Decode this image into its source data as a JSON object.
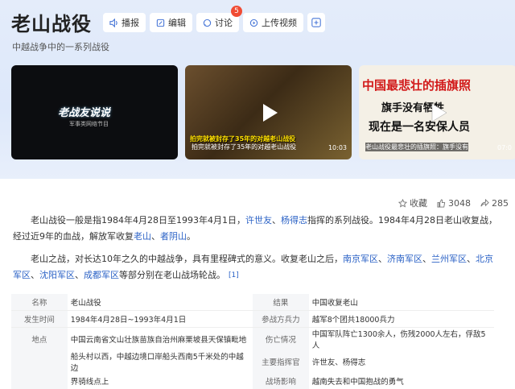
{
  "title": "老山战役",
  "subtitle": "中越战争中的一系列战役",
  "actions": [
    {
      "label": "播报",
      "icon": "speaker-icon"
    },
    {
      "label": "编辑",
      "icon": "edit-icon"
    },
    {
      "label": "讨论",
      "icon": "comment-icon",
      "badge": "5"
    },
    {
      "label": "上传视频",
      "icon": "video-icon"
    }
  ],
  "videos": [
    {
      "overlay": "老战友说说",
      "subtitle": "军事类网络节目",
      "caption": "",
      "duration": ""
    },
    {
      "overlay": "拍完就被封存了35年的对越老山战役",
      "caption": "拍完就被封存了35年的对越老山战役",
      "duration": "10:03"
    },
    {
      "overlay": "中国最悲壮的插旗照",
      "overlay2": "旗手没有牺牲",
      "overlay3": "现在是一名安保人员",
      "caption": "老山战役最悲壮的插旗照：旗手没有",
      "duration": "07:0"
    }
  ],
  "stats": {
    "collect": "收藏",
    "likes": "3048",
    "shares": "285"
  },
  "intro": {
    "p1": "老山战役一般是指1984年4月28日至1993年4月1日，",
    "p1_link1": "许世友",
    "p1_sep": "、",
    "p1_link2": "杨得志",
    "p1_b": "指挥的系列战役。1984年4月28日老山收复战，经过近9年的血战，解放军收复",
    "p1_link3": "老山",
    "p1_sep2": "、",
    "p1_link4": "者阴山",
    "p1_end": "。",
    "p2": "老山之战，对长达10年之久的中越战争，具有里程碑式的意义。收复老山之后，",
    "p2_links": [
      "南京军区",
      "济南军区",
      "兰州军区",
      "北京军区",
      "沈阳军区",
      "成都军区"
    ],
    "p2_sep": "、",
    "p2_end": "等部分别在老山战场轮战。",
    "ref": "[1]"
  },
  "infobox": [
    {
      "l1": "名称",
      "v1": "老山战役",
      "l2": "结果",
      "v2": "中国收复老山"
    },
    {
      "l1": "发生时间",
      "v1": "1984年4月28日~1993年4月1日",
      "l2": "参战方兵力",
      "v2": "越军8个团共18000兵力"
    },
    {
      "l1": "地点",
      "v1": "中国云南省文山壮族苗族自治州麻栗坡县天保镇毗地",
      "l2": "伤亡情况",
      "v2": "中国军队阵亡1300余人，伤残2000人左右，俘敌5人"
    },
    {
      "l1": "",
      "v1": "船头村以西，中越边境口岸船头西南5千米处的中越边",
      "l2": "主要指挥官",
      "v2": "许世友、杨得志"
    },
    {
      "l1": "",
      "v1": "界骑线点上",
      "l2": "战场影响",
      "v2": "越南失去和中国抱战的勇气"
    }
  ],
  "colors": {
    "accent": "#2b62c6",
    "badge": "#f04c34",
    "hero_bg": "#e4ecfa"
  }
}
